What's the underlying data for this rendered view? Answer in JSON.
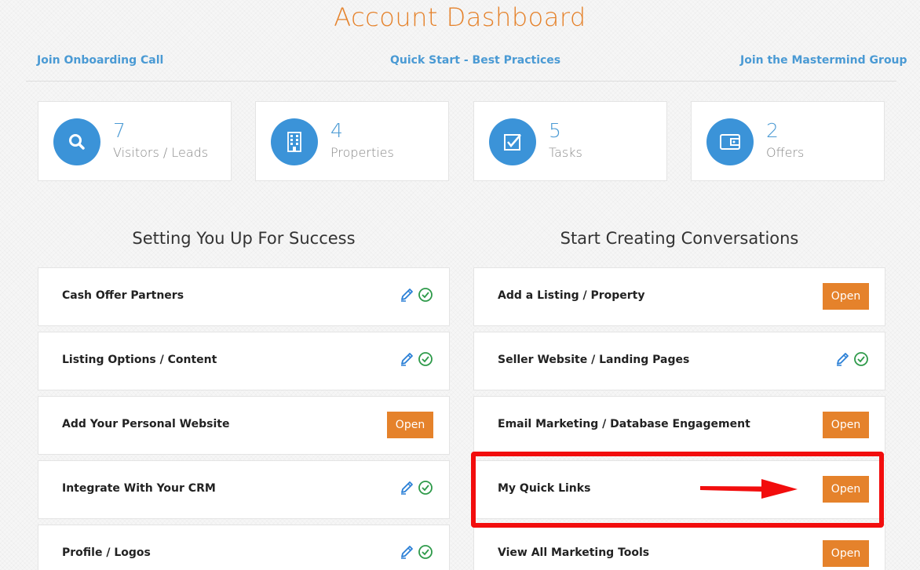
{
  "header": {
    "title": "Account Dashboard"
  },
  "top_links": {
    "onboarding": "Join Onboarding Call",
    "quick_start": "Quick Start - Best Practices",
    "mastermind": "Join the Mastermind Group"
  },
  "stats": [
    {
      "number": "7",
      "label": "Visitors / Leads",
      "icon": "search-icon"
    },
    {
      "number": "4",
      "label": "Properties",
      "icon": "building-icon"
    },
    {
      "number": "5",
      "label": "Tasks",
      "icon": "checkbox-icon"
    },
    {
      "number": "2",
      "label": "Offers",
      "icon": "wallet-icon"
    }
  ],
  "left_section": {
    "heading": "Setting You Up For Success",
    "items": [
      {
        "label": "Cash Offer Partners",
        "action": "edit-complete"
      },
      {
        "label": "Listing Options / Content",
        "action": "edit-complete"
      },
      {
        "label": "Add Your Personal Website",
        "action": "open",
        "button": "Open"
      },
      {
        "label": "Integrate With Your CRM",
        "action": "edit-complete"
      },
      {
        "label": "Profile / Logos",
        "action": "edit-complete"
      }
    ]
  },
  "right_section": {
    "heading": "Start Creating Conversations",
    "items": [
      {
        "label": "Add a Listing / Property",
        "action": "open",
        "button": "Open"
      },
      {
        "label": "Seller Website / Landing Pages",
        "action": "edit-complete"
      },
      {
        "label": "Email Marketing / Database Engagement",
        "action": "open",
        "button": "Open"
      },
      {
        "label": "My Quick Links",
        "action": "open",
        "button": "Open"
      },
      {
        "label": "View All Marketing Tools",
        "action": "open",
        "button": "Open"
      }
    ]
  },
  "colors": {
    "accent_orange": "#e5822b",
    "link_blue": "#4a9ad4",
    "icon_circle_blue": "#3b93d8",
    "check_green": "#2e9a4a",
    "pencil_blue": "#2a7fd6",
    "highlight_red": "#f20d0d"
  }
}
